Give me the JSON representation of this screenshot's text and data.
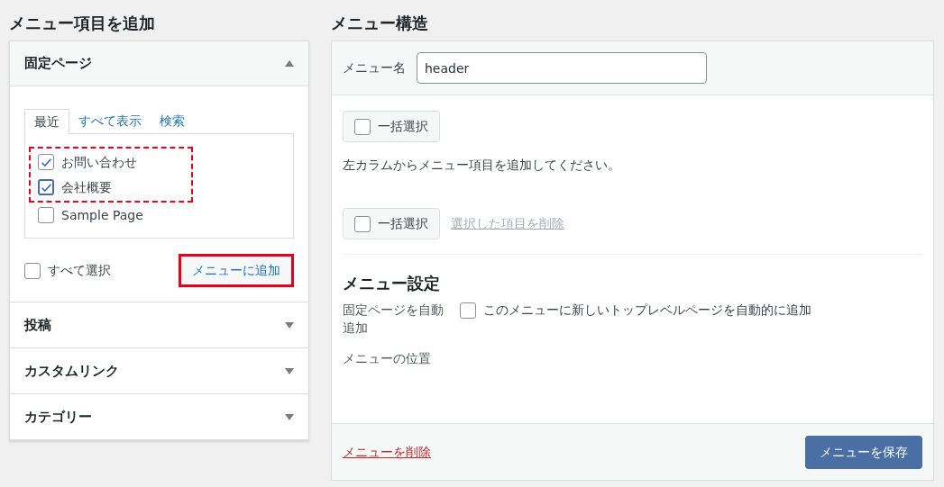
{
  "left": {
    "title": "メニュー項目を追加",
    "sections": [
      {
        "title": "固定ページ",
        "expanded": true,
        "tabs": [
          {
            "label": "最近",
            "selected": true
          },
          {
            "label": "すべて表示",
            "selected": false
          },
          {
            "label": "検索",
            "selected": false
          }
        ],
        "item_groups": [
          {
            "framed": true,
            "items": [
              {
                "label": "お問い合わせ",
                "checked": true
              },
              {
                "label": "会社概要",
                "checked": true
              }
            ]
          },
          {
            "framed": false,
            "items": [
              {
                "label": "Sample Page",
                "checked": false
              }
            ]
          }
        ],
        "select_all": {
          "label": "すべて選択",
          "checked": false
        },
        "add_button": {
          "label": "メニューに追加",
          "highlighted": true
        }
      },
      {
        "title": "投稿",
        "expanded": false
      },
      {
        "title": "カスタムリンク",
        "expanded": false
      },
      {
        "title": "カテゴリー",
        "expanded": false
      }
    ]
  },
  "right": {
    "title": "メニュー構造",
    "name_label": "メニュー名",
    "name_value": "header",
    "bulk_select_top": {
      "label": "一括選択",
      "checked": false
    },
    "instruction": "左カラムからメニュー項目を追加してください。",
    "bulk_select_bottom": {
      "label": "一括選択",
      "checked": false
    },
    "delete_selected": "選択した項目を削除",
    "settings": {
      "title": "メニュー設定",
      "auto_add_label": "固定ページを自動追加",
      "auto_add_option": {
        "label": "このメニューに新しいトップレベルページを自動的に追加",
        "checked": false
      },
      "location_label": "メニューの位置"
    },
    "delete_menu": "メニューを削除",
    "save_button": "メニューを保存"
  }
}
